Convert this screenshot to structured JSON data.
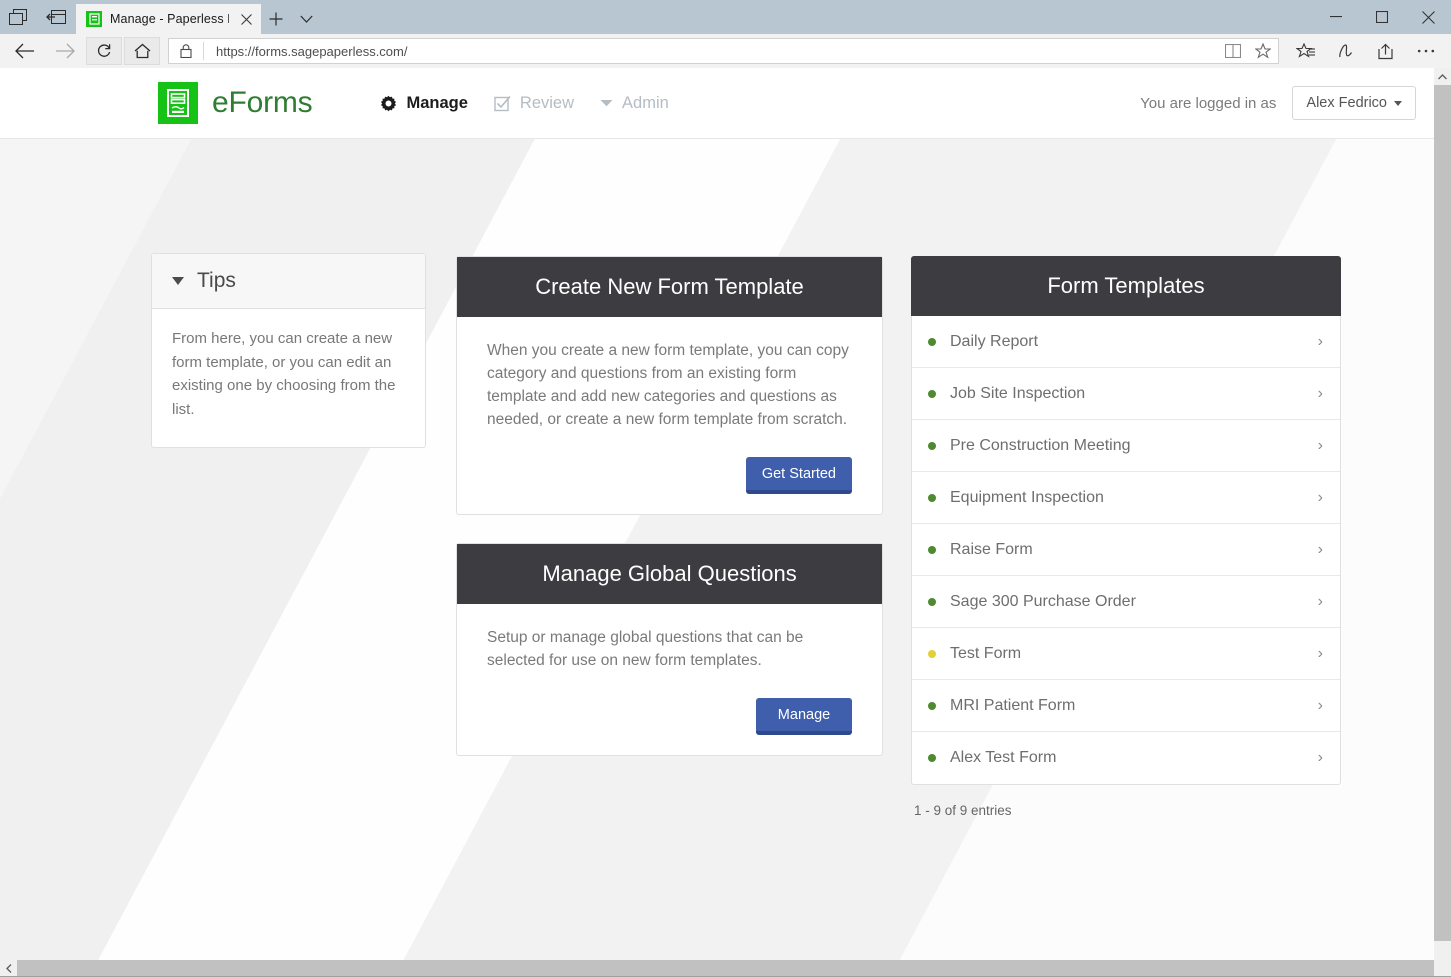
{
  "browser": {
    "tab": {
      "title": "Manage - Paperless For",
      "favicon": "eforms-favicon"
    },
    "new_tab_label": "+",
    "url": "https://forms.sagepaperless.com/",
    "window_controls": {
      "minimize": "minimize-icon",
      "maximize": "maximize-icon",
      "close": "close-icon"
    },
    "toolbar_icons": [
      "set-tabs-aside-icon",
      "tabs-aside-list-icon",
      "back-icon",
      "forward-icon",
      "refresh-icon",
      "home-icon",
      "lock-icon",
      "reading-view-icon",
      "favorite-star-icon",
      "hub-icon",
      "web-note-icon",
      "share-icon",
      "more-icon"
    ]
  },
  "app": {
    "brand": {
      "name": "eForms",
      "logo": "eforms-logo-icon",
      "color": "#2f7d32",
      "logo_bg": "#17c217"
    },
    "nav": [
      {
        "label": "Manage",
        "icon": "gear-icon",
        "active": true
      },
      {
        "label": "Review",
        "icon": "checkbox-icon",
        "active": false
      },
      {
        "label": "Admin",
        "icon": "caret-down-icon",
        "active": false
      }
    ],
    "user": {
      "logged_in_text": "You are logged in as",
      "name": "Alex Fedrico"
    }
  },
  "tips": {
    "title": "Tips",
    "body": "From here, you can create a new form template, or you can edit an existing one by choosing from the list."
  },
  "cards": [
    {
      "title": "Create New Form Template",
      "text": "When you create a new form template, you can copy category and questions from an existing form template and add new categories and questions as needed, or create a new form template from scratch.",
      "button": "Get Started"
    },
    {
      "title": "Manage Global Questions",
      "text": "Setup or manage global questions that can be selected for use on new form templates.",
      "button": "Manage"
    }
  ],
  "templates": {
    "title": "Form Templates",
    "items": [
      {
        "label": "Daily Report",
        "status": "green"
      },
      {
        "label": "Job Site Inspection",
        "status": "green"
      },
      {
        "label": "Pre Construction Meeting",
        "status": "green"
      },
      {
        "label": "Equipment Inspection",
        "status": "green"
      },
      {
        "label": "Raise Form",
        "status": "green"
      },
      {
        "label": "Sage 300 Purchase Order",
        "status": "green"
      },
      {
        "label": "Test Form",
        "status": "yellow"
      },
      {
        "label": "MRI Patient Form",
        "status": "green"
      },
      {
        "label": "Alex Test Form",
        "status": "green"
      }
    ],
    "entries": "1 - 9 of 9 entries",
    "colors": {
      "green": "#4f8a2e",
      "yellow": "#e2d035",
      "header_bg": "#3c3c41",
      "primary_button": "#3f5fac"
    }
  }
}
